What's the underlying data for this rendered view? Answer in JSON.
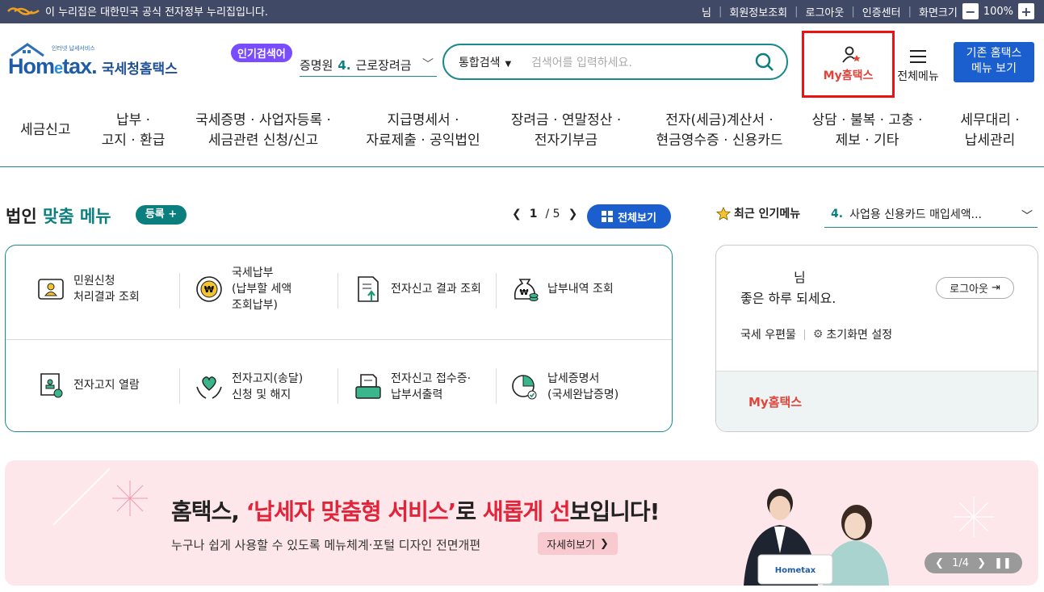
{
  "topbar": {
    "gov_notice": "이 누리집은 대한민국 공식 전자정부 누리집입니다.",
    "user_suffix": "님",
    "links": [
      "회원정보조회",
      "로그아웃",
      "인증센터",
      "화면크기"
    ],
    "zoom": "100%"
  },
  "logo": {
    "small": "인터넷 납세서비스",
    "main": "Hometax.",
    "korean": "국세청홈택스"
  },
  "search": {
    "popular_label": "인기검색어",
    "popular_prefix": "증명원",
    "popular_rank": "4.",
    "popular_term": "근로장려금",
    "scope": "통합검색",
    "placeholder": "검색어를 입력하세요."
  },
  "header": {
    "myhometax": "My홈택스",
    "all_menu": "전체메뉴",
    "old_hometax_line1": "기존 홈택스",
    "old_hometax_line2": "메뉴 보기"
  },
  "gnb": [
    {
      "l1": "세금신고",
      "l2": ""
    },
    {
      "l1": "납부 ·",
      "l2": "고지 · 환급"
    },
    {
      "l1": "국세증명 · 사업자등록 ·",
      "l2": "세금관련 신청/신고"
    },
    {
      "l1": "지급명세서 ·",
      "l2": "자료제출 · 공익법인"
    },
    {
      "l1": "장려금 · 연말정산 ·",
      "l2": "전자기부금"
    },
    {
      "l1": "전자(세금)계산서 ·",
      "l2": "현금영수증 · 신용카드"
    },
    {
      "l1": "상담 · 불복 · 고충 ·",
      "l2": "제보 · 기타"
    },
    {
      "l1": "세무대리 ·",
      "l2": "납세관리"
    }
  ],
  "custom_menu": {
    "title_prefix": "법인",
    "title_green": "맞춤 메뉴",
    "register": "등록 +",
    "page_current": "1",
    "page_total": "/ 5",
    "view_all": "전체보기",
    "items": [
      [
        "민원신청",
        "처리결과 조회"
      ],
      [
        "국세납부",
        "(납부할 세액",
        "조회납부)"
      ],
      [
        "전자신고 결과 조회"
      ],
      [
        "납부내역 조회"
      ],
      [
        "전자고지 열람"
      ],
      [
        "전자고지(송달)",
        "신청 및 해지"
      ],
      [
        "전자신고 접수증·",
        "납부서출력"
      ],
      [
        "납세증명서",
        "(국세완납증명)"
      ]
    ]
  },
  "recent": {
    "label": "최근 인기메뉴",
    "rank": "4.",
    "item": "사업용 신용카드 매입세액..."
  },
  "user": {
    "nim": "님",
    "greeting": "좋은 하루 되세요.",
    "logout": "로그아웃",
    "link1": "국세 우편물",
    "link2": "초기화면 설정",
    "myhometax": "My홈택스"
  },
  "banner": {
    "head_a": "홈택스, ",
    "head_b": "‘납세자 맞춤형 서비스’",
    "head_c": "로 ",
    "head_d": "새롭게 선",
    "head_e": "보입니다!",
    "sub": "누구나 쉽게 사용할 수 있도록 메뉴체계·포털 디자인 전면개편",
    "more": "자세히보기",
    "page": "1/4"
  },
  "colors": {
    "teal": "#0b7e7e",
    "blue": "#1b5fcf",
    "red": "#e0443a",
    "topbar": "#404a66"
  }
}
